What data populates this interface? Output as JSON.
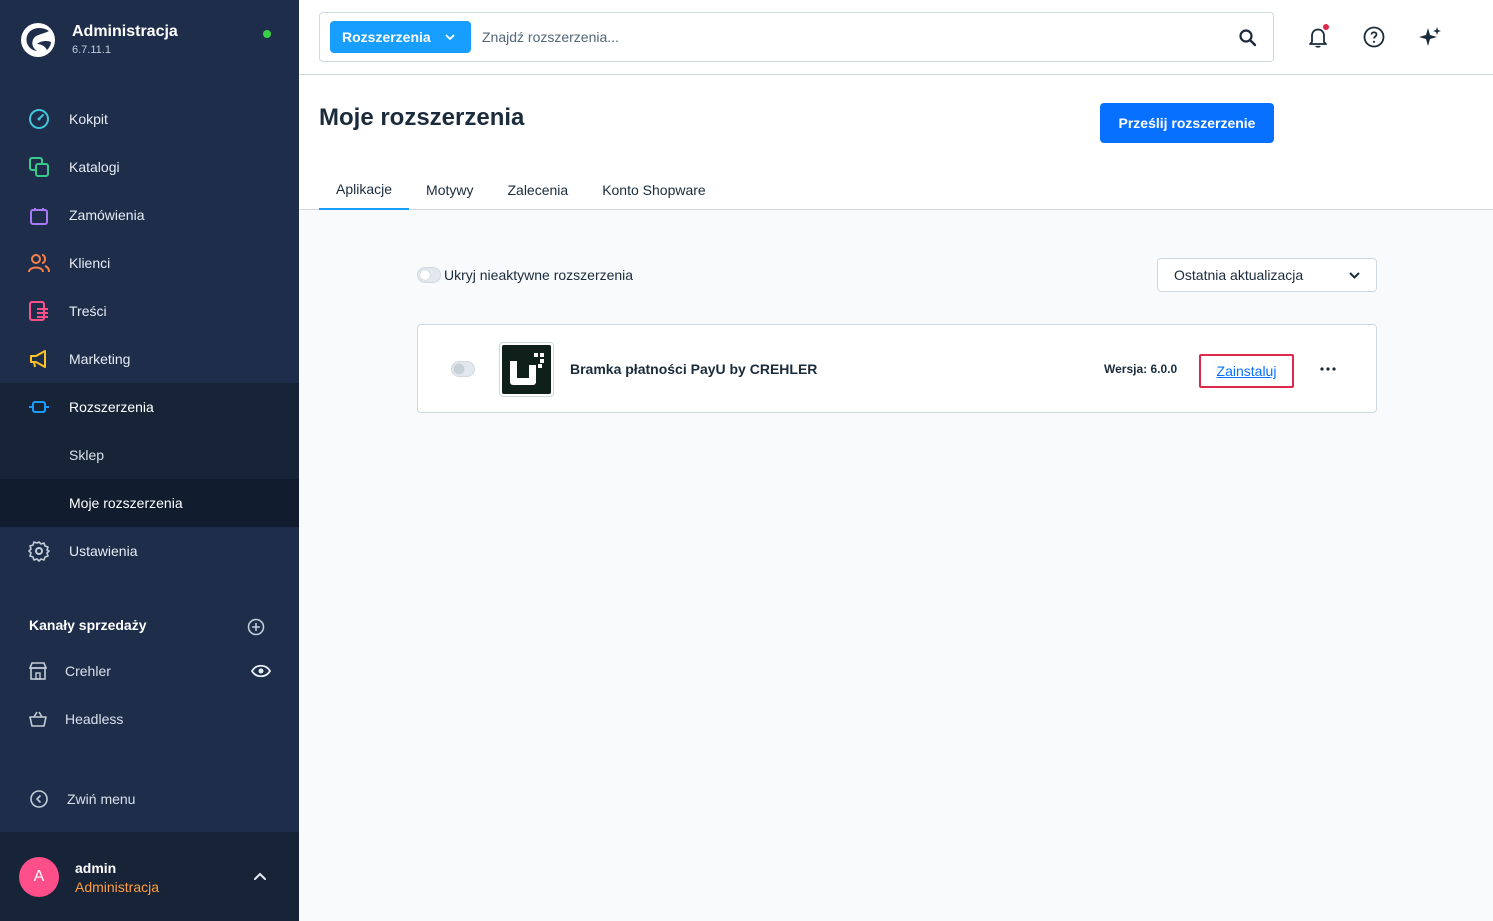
{
  "brand": {
    "title": "Administracja",
    "version": "6.7.11.1"
  },
  "nav": {
    "items": [
      {
        "label": "Kokpit",
        "icon": "dashboard-icon",
        "color": "#43c3d7"
      },
      {
        "label": "Katalogi",
        "icon": "catalog-icon",
        "color": "#39c98a"
      },
      {
        "label": "Zamówienia",
        "icon": "shopping-bag-icon",
        "color": "#a77af7"
      },
      {
        "label": "Klienci",
        "icon": "customers-icon",
        "color": "#f8804a"
      },
      {
        "label": "Treści",
        "icon": "content-icon",
        "color": "#ff4f8b"
      },
      {
        "label": "Marketing",
        "icon": "megaphone-icon",
        "color": "#ffc228"
      },
      {
        "label": "Rozszerzenia",
        "icon": "plug-icon",
        "color": "#189eff"
      }
    ],
    "sub": [
      {
        "label": "Sklep"
      },
      {
        "label": "Moje rozszerzenia"
      }
    ],
    "settings": {
      "label": "Ustawienia",
      "icon": "gear-icon"
    }
  },
  "channels": {
    "title": "Kanały sprzedaży",
    "items": [
      {
        "label": "Crehler",
        "icon": "storefront-icon"
      },
      {
        "label": "Headless",
        "icon": "basket-icon"
      }
    ]
  },
  "collapse_label": "Zwiń menu",
  "user": {
    "initial": "A",
    "name": "admin",
    "role": "Administracja"
  },
  "search": {
    "type_label": "Rozszerzenia",
    "placeholder": "Znajdź rozszerzenia..."
  },
  "page": {
    "title": "Moje rozszerzenia",
    "upload_button": "Prześlij rozszerzenie",
    "tabs": [
      "Aplikacje",
      "Motywy",
      "Zalecenia",
      "Konto Shopware"
    ]
  },
  "filters": {
    "hide_inactive_label": "Ukryj nieaktywne rozszerzenia",
    "sort_value": "Ostatnia aktualizacja"
  },
  "extension": {
    "name": "Bramka płatności PayU by CREHLER",
    "version": "Wersja: 6.0.0",
    "install_label": "Zainstaluj"
  }
}
